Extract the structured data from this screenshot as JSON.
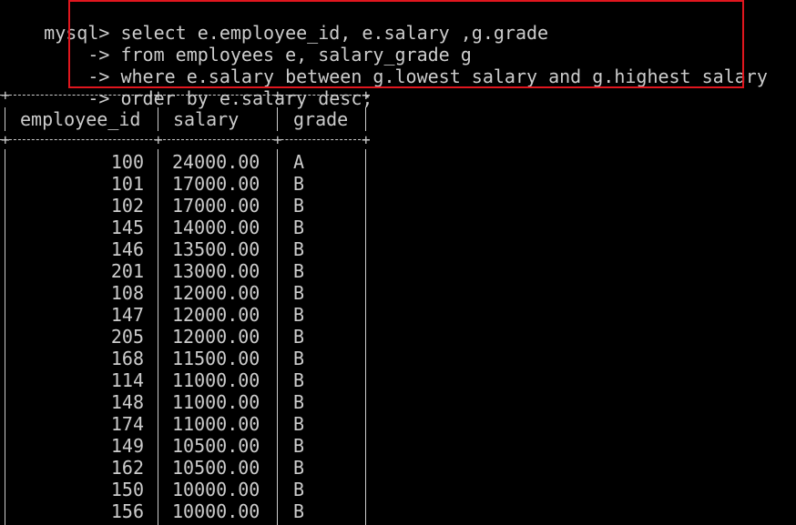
{
  "terminal": {
    "prompt_main": "mysql>",
    "prompt_cont": "    ->",
    "query_lines": [
      "select e.employee_id, e.salary ,g.grade",
      "from employees e, salary_grade g",
      "where e.salary between g.lowest_salary and g.highest_salary",
      "order by e.salary desc;"
    ],
    "highlight_color": "#e0161e",
    "text_color": "#cccccc",
    "background_color": "#000000"
  },
  "result": {
    "headers": [
      "employee_id",
      "salary",
      "grade"
    ],
    "rows": [
      [
        "100",
        "24000.00",
        "A"
      ],
      [
        "101",
        "17000.00",
        "B"
      ],
      [
        "102",
        "17000.00",
        "B"
      ],
      [
        "145",
        "14000.00",
        "B"
      ],
      [
        "146",
        "13500.00",
        "B"
      ],
      [
        "201",
        "13000.00",
        "B"
      ],
      [
        "108",
        "12000.00",
        "B"
      ],
      [
        "147",
        "12000.00",
        "B"
      ],
      [
        "205",
        "12000.00",
        "B"
      ],
      [
        "168",
        "11500.00",
        "B"
      ],
      [
        "114",
        "11000.00",
        "B"
      ],
      [
        "148",
        "11000.00",
        "B"
      ],
      [
        "174",
        "11000.00",
        "B"
      ],
      [
        "149",
        "10500.00",
        "B"
      ],
      [
        "162",
        "10500.00",
        "B"
      ],
      [
        "150",
        "10000.00",
        "B"
      ],
      [
        "156",
        "10000.00",
        "B"
      ]
    ]
  }
}
